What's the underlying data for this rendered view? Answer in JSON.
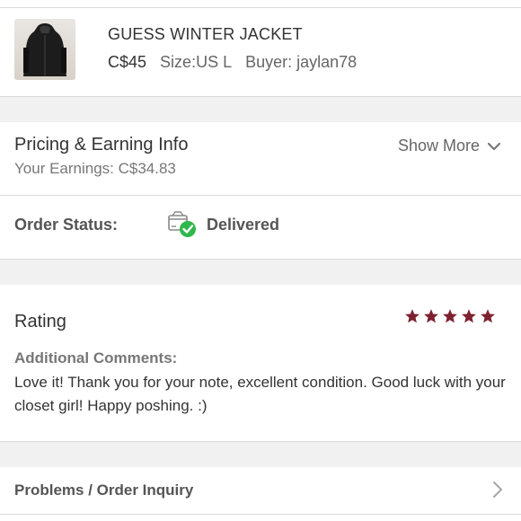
{
  "item": {
    "title": "GUESS WINTER JACKET",
    "price": "C$45",
    "size": "Size:US L",
    "buyer": "Buyer: jaylan78",
    "thumbnail_icon": "jacket-photo"
  },
  "pricing": {
    "title": "Pricing & Earning Info",
    "earnings": "Your Earnings: C$34.83",
    "show_more": "Show More"
  },
  "order_status": {
    "label": "Order Status:",
    "value": "Delivered",
    "icon": "delivered-box-check-icon"
  },
  "rating": {
    "title": "Rating",
    "stars": 5,
    "star_color": "#7d2030",
    "comments_label": "Additional Comments:",
    "comment": "Love it! Thank you for your note, excellent condition. Good luck with your closet girl! Happy poshing. :)"
  },
  "problems": {
    "label": "Problems / Order Inquiry"
  },
  "colors": {
    "gap_bg": "#f1f1f1",
    "divider": "#d9d9d9",
    "check_green": "#2eb84b"
  }
}
